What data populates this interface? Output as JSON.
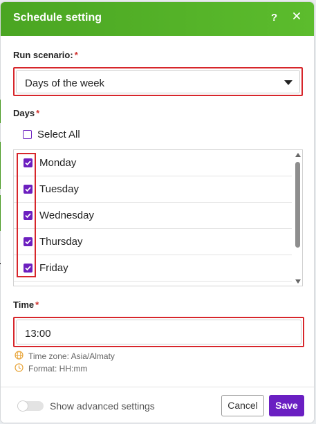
{
  "dialog": {
    "title": "Schedule setting",
    "help_label": "?",
    "close_icon": "close-icon"
  },
  "run_scenario": {
    "label": "Run scenario:",
    "required_mark": "*",
    "selected_value": "Days of the week"
  },
  "days": {
    "label": "Days",
    "required_mark": "*",
    "select_all_label": "Select All",
    "select_all_checked": false,
    "items": [
      {
        "label": "Monday",
        "checked": true
      },
      {
        "label": "Tuesday",
        "checked": true
      },
      {
        "label": "Wednesday",
        "checked": true
      },
      {
        "label": "Thursday",
        "checked": true
      },
      {
        "label": "Friday",
        "checked": true
      }
    ]
  },
  "time": {
    "label": "Time",
    "required_mark": "*",
    "value": "13:00",
    "timezone_hint": "Time zone: Asia/Almaty",
    "format_hint": "Format: HH:mm"
  },
  "footer": {
    "advanced_toggle_label": "Show advanced settings",
    "advanced_enabled": false,
    "cancel_label": "Cancel",
    "save_label": "Save"
  },
  "colors": {
    "header_green": "#4aa522",
    "accent_purple": "#6a1fc2",
    "highlight_red": "#d7262b",
    "required_red": "#d0312d"
  }
}
